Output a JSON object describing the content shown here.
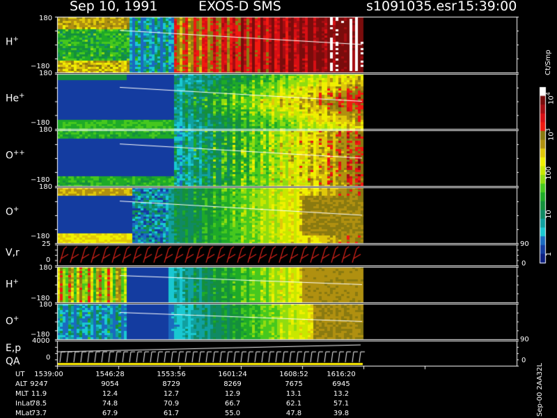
{
  "header": {
    "date": "Sep 10, 1991",
    "instrument": "EXOS-D SMS",
    "file": "s1091035.esr",
    "time": "15:39:00"
  },
  "panels": [
    {
      "key": "h1",
      "label": "H",
      "sup": "+",
      "top_tick": "180",
      "bottom_tick": "−180"
    },
    {
      "key": "he",
      "label": "He",
      "sup": "+",
      "top_tick": "180",
      "bottom_tick": "−180"
    },
    {
      "key": "opp",
      "label": "O",
      "sup": "++",
      "top_tick": "180",
      "bottom_tick": "−180"
    },
    {
      "key": "o1",
      "label": "O",
      "sup": "+",
      "top_tick": "180",
      "bottom_tick": "−180"
    },
    {
      "key": "vr",
      "label": "V,r",
      "sup": "",
      "top_tick": "25",
      "bottom_tick": "0",
      "right_top": "90",
      "right_bottom": "0"
    },
    {
      "key": "h2",
      "label": "H",
      "sup": "+",
      "top_tick": "180",
      "bottom_tick": "−180"
    },
    {
      "key": "o2",
      "label": "O",
      "sup": "+",
      "top_tick": "180",
      "bottom_tick": "−180"
    },
    {
      "key": "ep",
      "label": "E,p",
      "sup": "",
      "label2": "QA",
      "top_tick": "4000",
      "bottom_tick": "0",
      "right_top": "90",
      "right_bottom": "0"
    }
  ],
  "colorbar": {
    "unit": "Ct/Smp",
    "ticks": [
      {
        "label": "10",
        "sup": "4"
      },
      {
        "label": "10",
        "sup": "3"
      },
      {
        "label": "100",
        "sup": ""
      },
      {
        "label": "10",
        "sup": ""
      },
      {
        "label": "1",
        "sup": ""
      }
    ],
    "colors": [
      "#ffffff",
      "#7a0c0c",
      "#a60d12",
      "#d80f14",
      "#f01a10",
      "#8a7a10",
      "#b09010",
      "#e0c80a",
      "#f0f000",
      "#c8e800",
      "#90dc10",
      "#46c81e",
      "#1eaa28",
      "#14903c",
      "#108a64",
      "#10a0a0",
      "#19c8d2",
      "#1a6abf",
      "#143ca0",
      "#0c1e80"
    ]
  },
  "time_table": {
    "rows": [
      {
        "label": "UT",
        "values": [
          "1539:00",
          "1546:28",
          "1553:56",
          "1601:24",
          "1608:52",
          "1616:20"
        ]
      },
      {
        "label": "ALT",
        "values": [
          "9247",
          "9054",
          "8729",
          "8269",
          "7675",
          "6945"
        ]
      },
      {
        "label": "MLT",
        "values": [
          "11.9",
          "12.4",
          "12.7",
          "12.9",
          "13.1",
          "13.2"
        ]
      },
      {
        "label": "InLat",
        "values": [
          "78.5",
          "74.8",
          "70.9",
          "66.7",
          "62.1",
          "57.1"
        ]
      },
      {
        "label": "MLat",
        "values": [
          "73.7",
          "67.9",
          "61.7",
          "55.0",
          "47.8",
          "39.8"
        ]
      }
    ]
  },
  "footer": {
    "version": "Sep-00 2AA32L"
  }
}
